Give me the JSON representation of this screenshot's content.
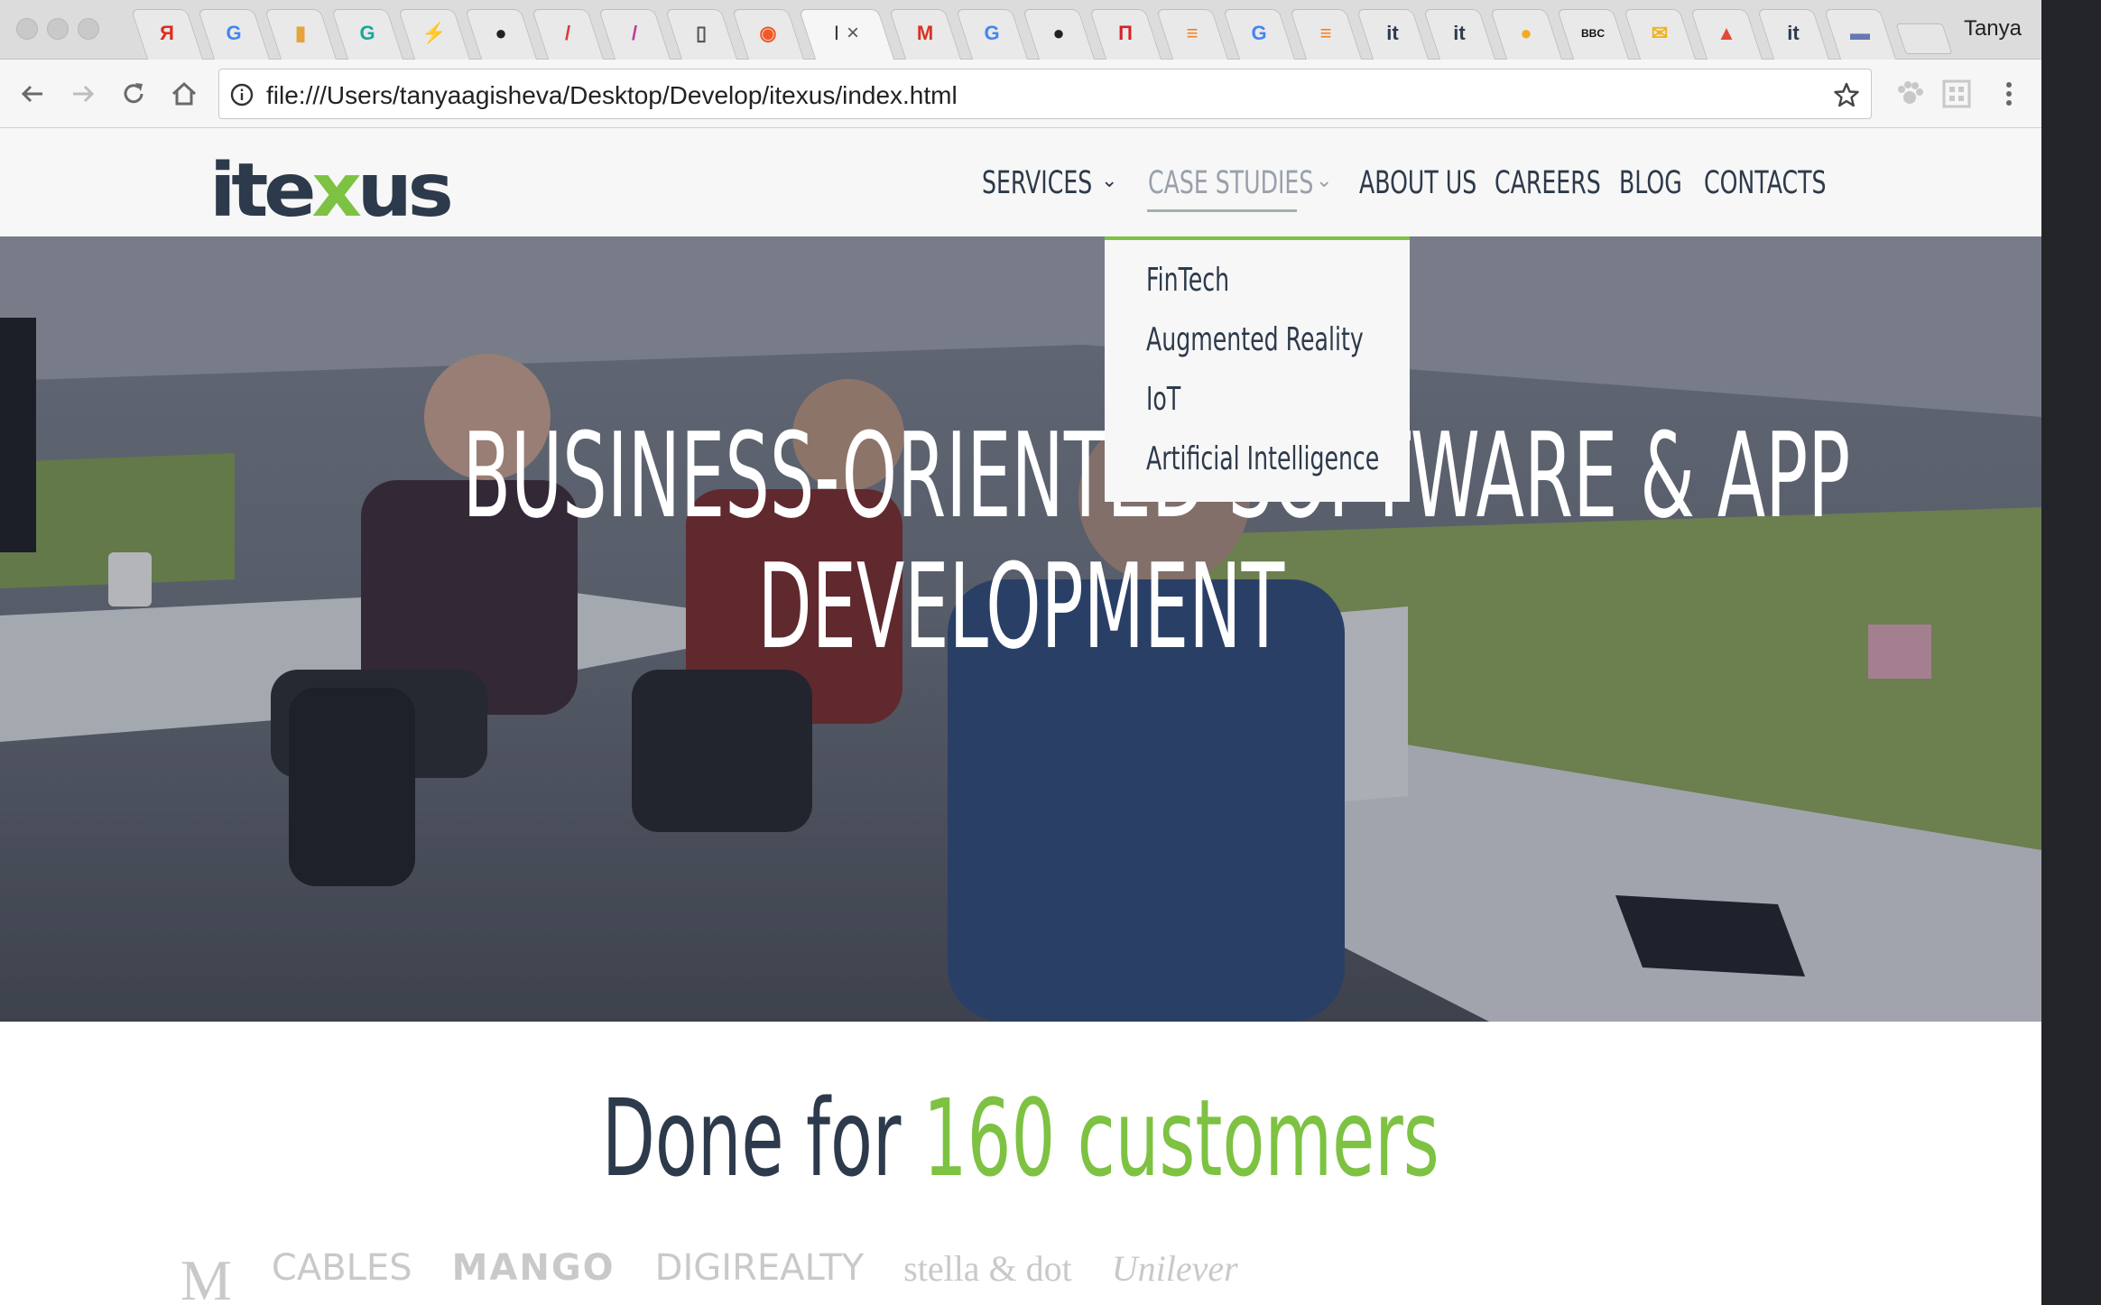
{
  "browser": {
    "profile_name": "Tanya",
    "active_tab_title": "I",
    "url": "file:///Users/tanyaagisheva/Desktop/Develop/itexus/index.html",
    "tabs": [
      {
        "icon": "yandex-icon",
        "glyph": "Я",
        "color": "#e22b1c"
      },
      {
        "icon": "google-icon",
        "glyph": "G",
        "color": "#4285f4"
      },
      {
        "icon": "book-icon",
        "glyph": "▮",
        "color": "#e6a33c"
      },
      {
        "icon": "grammarly-icon",
        "glyph": "G",
        "color": "#15a99b"
      },
      {
        "icon": "lightning-icon",
        "glyph": "⚡",
        "color": "#d72b2b"
      },
      {
        "icon": "github-icon",
        "glyph": "●",
        "color": "#222222"
      },
      {
        "icon": "pen-icon",
        "glyph": "/",
        "color": "#d93b32"
      },
      {
        "icon": "pen-icon",
        "glyph": "/",
        "color": "#c0399b"
      },
      {
        "icon": "document-icon",
        "glyph": "▯",
        "color": "#555555"
      },
      {
        "icon": "brave-icon",
        "glyph": "◉",
        "color": "#f05a28"
      },
      {
        "icon": "active-tab",
        "glyph": "",
        "color": "#333333"
      },
      {
        "icon": "gmail-icon",
        "glyph": "M",
        "color": "#d93025"
      },
      {
        "icon": "google-icon",
        "glyph": "G",
        "color": "#4285f4"
      },
      {
        "icon": "github-icon",
        "glyph": "●",
        "color": "#222222"
      },
      {
        "icon": "flag-icon",
        "glyph": "П",
        "color": "#d5232b"
      },
      {
        "icon": "stackoverflow-icon",
        "glyph": "≡",
        "color": "#f48024"
      },
      {
        "icon": "google-icon",
        "glyph": "G",
        "color": "#4285f4"
      },
      {
        "icon": "stackoverflow-icon",
        "glyph": "≡",
        "color": "#f48024"
      },
      {
        "icon": "itexus-icon",
        "glyph": "it",
        "color": "#2d3a4b"
      },
      {
        "icon": "itexus-icon",
        "glyph": "it",
        "color": "#2d3a4b"
      },
      {
        "icon": "circle-icon",
        "glyph": "●",
        "color": "#f7a823"
      },
      {
        "icon": "bbc-icon",
        "glyph": "BBC",
        "color": "#111111"
      },
      {
        "icon": "mail-icon",
        "glyph": "✉",
        "color": "#f2b21b"
      },
      {
        "icon": "image-icon",
        "glyph": "▲",
        "color": "#e2493a"
      },
      {
        "icon": "itexus-icon",
        "glyph": "it",
        "color": "#2d3a4b"
      },
      {
        "icon": "window-icon",
        "glyph": "▬",
        "color": "#6678b5"
      }
    ]
  },
  "site": {
    "logo": {
      "pre": "ite",
      "x": "x",
      "post": "us"
    },
    "nav": [
      {
        "label": "SERVICES",
        "has_caret": true
      },
      {
        "label": "CASE STUDIES",
        "has_caret": true
      },
      {
        "label": "ABOUT US",
        "has_caret": false
      },
      {
        "label": "CAREERS",
        "has_caret": false
      },
      {
        "label": "BLOG",
        "has_caret": false
      },
      {
        "label": "CONTACTS",
        "has_caret": false
      }
    ],
    "dropdown": [
      "FinTech",
      "Augmented Reality",
      "IoT",
      "Artificial Intelligence"
    ],
    "hero": {
      "line1": "BUSINESS-ORIENTED SOFTWARE & APP",
      "line2": "DEVELOPMENT"
    },
    "customers": {
      "prefix": "Done for",
      "highlight": "160 customers"
    },
    "clients": [
      "M",
      "CABLES",
      "MANGO",
      "DIGIREALTY",
      "stella & dot",
      "Unilever"
    ],
    "colors": {
      "navy": "#2d3a4b",
      "green": "#7dc242"
    }
  }
}
